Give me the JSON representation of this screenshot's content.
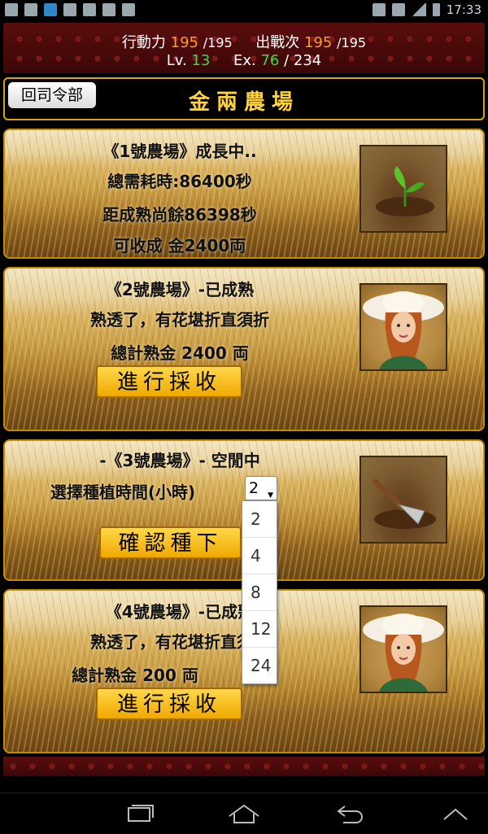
{
  "statusbar": {
    "time": "17:33"
  },
  "header": {
    "ap_label": "行動力",
    "ap_value": "195",
    "ap_max": "/195",
    "sortie_label": "出戰次",
    "sortie_value": "195",
    "sortie_max": "/195",
    "lv_label": "Lv.",
    "lv_value": "13",
    "ex_label": "Ex.",
    "ex_value": "76",
    "ex_max": "/ 234"
  },
  "titlebar": {
    "back_label": "回司令部",
    "title": "金兩農場"
  },
  "farms": [
    {
      "line1": "《1號農場》成長中..",
      "line2": "總需耗時:86400秒",
      "line3": "距成熟尚餘86398秒",
      "line4": "可收成 金2400両"
    },
    {
      "line1": "《2號農場》-已成熟",
      "line2": "熟透了，有花堪折直須折",
      "line3": "總計熟金 2400 両",
      "button": "進行採收"
    },
    {
      "line1": "-《3號農場》- 空閒中",
      "line2": "選擇種植時間(小時)",
      "selected": "2",
      "button": "確認種下"
    },
    {
      "line1": "《4號農場》-已成熟",
      "line2": "熟透了，有花堪折直須折",
      "line3": "總計熟金 200 両",
      "button": "進行採收"
    }
  ],
  "dropdown_options": [
    "2",
    "4",
    "8",
    "12",
    "24"
  ]
}
